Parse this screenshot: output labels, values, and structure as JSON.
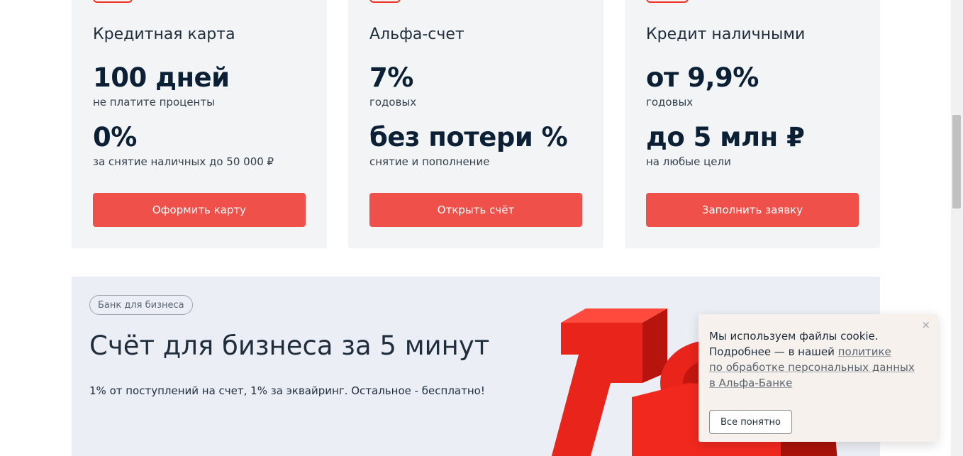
{
  "products": [
    {
      "title": "Кредитная карта",
      "stat1_value": "100 дней",
      "stat1_caption": "не платите проценты",
      "stat2_value": "0%",
      "stat2_caption": "за снятие наличных до 50 000 ₽",
      "button_label": "Оформить карту"
    },
    {
      "title": "Альфа-счет",
      "stat1_value": "7%",
      "stat1_caption": "годовых",
      "stat2_value": "без потери %",
      "stat2_caption": "снятие и пополнение",
      "button_label": "Открыть счёт"
    },
    {
      "title": "Кредит наличными",
      "stat1_value": "от 9,9%",
      "stat1_caption": "годовых",
      "stat2_value": "до 5 млн ₽",
      "stat2_caption": "на любые цели",
      "button_label": "Заполнить заявку"
    }
  ],
  "business": {
    "tag": "Банк для бизнеса",
    "headline": "Счёт для бизнеса за 5 минут",
    "subtitle": "1% от поступлений на счет, 1% за эквайринг. Остальное - бесплатно!"
  },
  "cookie": {
    "line1": "Мы используем файлы cookie.",
    "line2_prefix": "Подробнее — в нашей ",
    "link_part1": "политике",
    "link_part2": "по обработке персональных данных",
    "link_part3": "в Альфа-Банке",
    "close_icon": "×",
    "button_label": "Все понятно"
  },
  "colors": {
    "accent_red": "#ef5049",
    "card_bg": "#f3f4f5",
    "promo_bg": "#eceef6",
    "cookie_bg": "#f6f1ec"
  }
}
